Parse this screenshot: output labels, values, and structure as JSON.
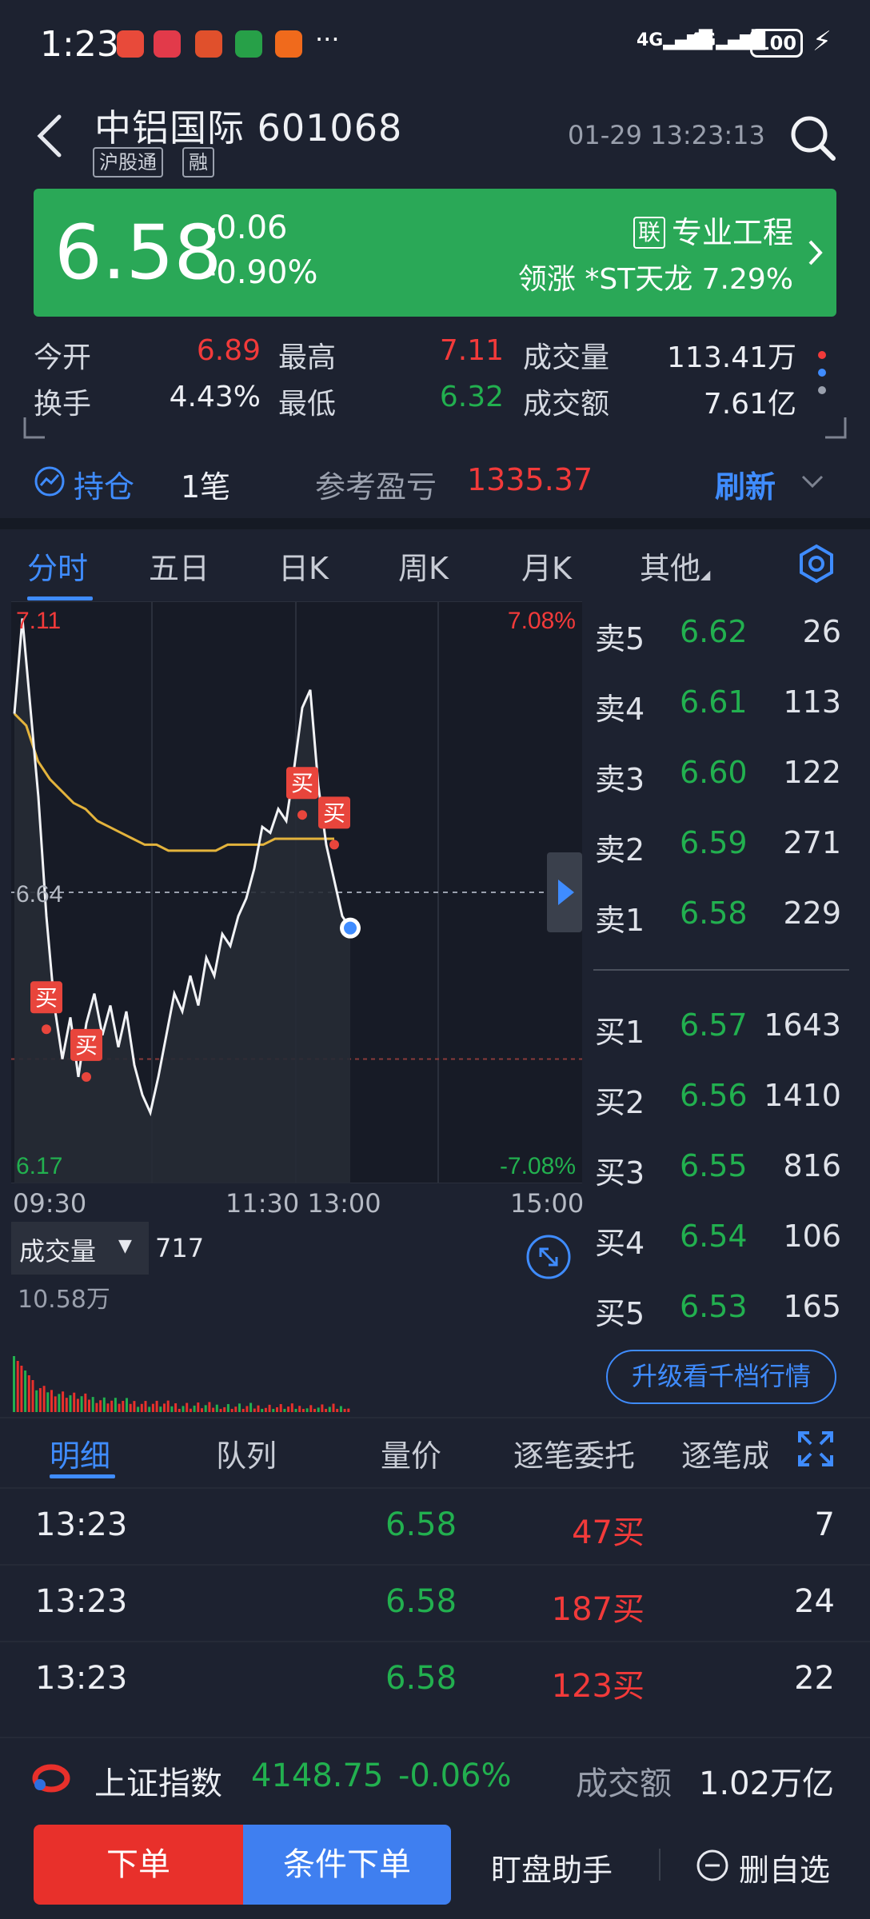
{
  "status_bar": {
    "time": "1:23",
    "more": "···",
    "net1": "4G",
    "net2": "4G",
    "battery": "100"
  },
  "header": {
    "title": "中铝国际 601068",
    "tags": [
      "沪股通",
      "融"
    ],
    "datetime": "01-29 13:23:13"
  },
  "quote": {
    "price": "6.58",
    "change": "-0.06",
    "change_pct": "-0.90%",
    "sector_tag": "联",
    "sector": "专业工程",
    "leader": "领涨 *ST天龙 7.29%"
  },
  "stats": [
    {
      "label": "今开",
      "value": "6.89",
      "color": "#f23a3a"
    },
    {
      "label": "最高",
      "value": "7.11",
      "color": "#f23a3a"
    },
    {
      "label": "成交量",
      "value": "113.41万",
      "color": "#eceef3"
    },
    {
      "label": "换手",
      "value": "4.43%",
      "color": "#eceef3"
    },
    {
      "label": "最低",
      "value": "6.32",
      "color": "#22b04f"
    },
    {
      "label": "成交额",
      "value": "7.61亿",
      "color": "#eceef3"
    }
  ],
  "position": {
    "label": "持仓",
    "count": "1笔",
    "pnl_label": "参考盈亏",
    "pnl": "1335.37",
    "refresh": "刷新"
  },
  "chart_tabs": [
    "分时",
    "五日",
    "日K",
    "周K",
    "月K",
    "其他"
  ],
  "chart": {
    "high_price": "7.11",
    "high_pct": "7.08%",
    "ref_price": "6.64",
    "low_price": "6.17",
    "low_pct": "-7.08%",
    "times": [
      "09:30",
      "11:30 13:00",
      "15:00"
    ],
    "buy_marker": "买",
    "volume_label": "成交量",
    "volume_current": "717",
    "volume_max": "10.58万"
  },
  "chart_data": {
    "type": "line",
    "ylim": [
      6.17,
      7.11
    ],
    "ref": 6.64,
    "series": [
      {
        "values": [
          6.94,
          7.1,
          6.95,
          6.8,
          6.6,
          6.45,
          6.36,
          6.43,
          6.33,
          6.42,
          6.47,
          6.4,
          6.45,
          6.38,
          6.44,
          6.35,
          6.3,
          6.27,
          6.33,
          6.4,
          6.47,
          6.44,
          6.5,
          6.45,
          6.53,
          6.5,
          6.57,
          6.55,
          6.6,
          6.63,
          6.68,
          6.75,
          6.74,
          6.78,
          6.76,
          6.85,
          6.95,
          6.98,
          6.82,
          6.72,
          6.66,
          6.6,
          6.58
        ]
      },
      {
        "values": [
          6.94,
          6.92,
          6.86,
          6.83,
          6.81,
          6.79,
          6.78,
          6.76,
          6.75,
          6.74,
          6.73,
          6.72,
          6.72,
          6.71,
          6.71,
          6.71,
          6.71,
          6.71,
          6.72,
          6.72,
          6.72,
          6.72,
          6.73,
          6.73,
          6.73,
          6.73,
          6.73,
          6.73
        ]
      }
    ]
  },
  "order_book": {
    "asks": [
      {
        "label": "卖5",
        "price": "6.62",
        "vol": "26"
      },
      {
        "label": "卖4",
        "price": "6.61",
        "vol": "113"
      },
      {
        "label": "卖3",
        "price": "6.60",
        "vol": "122"
      },
      {
        "label": "卖2",
        "price": "6.59",
        "vol": "271"
      },
      {
        "label": "卖1",
        "price": "6.58",
        "vol": "229"
      }
    ],
    "bids": [
      {
        "label": "买1",
        "price": "6.57",
        "vol": "1643"
      },
      {
        "label": "买2",
        "price": "6.56",
        "vol": "1410"
      },
      {
        "label": "买3",
        "price": "6.55",
        "vol": "816"
      },
      {
        "label": "买4",
        "price": "6.54",
        "vol": "106"
      },
      {
        "label": "买5",
        "price": "6.53",
        "vol": "165"
      }
    ],
    "upgrade": "升级看千档行情"
  },
  "detail_tabs": [
    "明细",
    "队列",
    "量价",
    "逐笔委托",
    "逐笔成交"
  ],
  "trades": [
    {
      "time": "13:23",
      "price": "6.58",
      "vol": "47买",
      "count": "7"
    },
    {
      "time": "13:23",
      "price": "6.58",
      "vol": "187买",
      "count": "24"
    },
    {
      "time": "13:23",
      "price": "6.58",
      "vol": "123买",
      "count": "22"
    }
  ],
  "index_bar": {
    "name": "上证指数",
    "value": "4148.75",
    "change": "-0.06%",
    "turnover_label": "成交额",
    "turnover": "1.02万亿"
  },
  "actions": {
    "order": "下单",
    "conditional": "条件下单",
    "assistant": "盯盘助手",
    "remove": "删自选"
  },
  "colors": {
    "up": "#f23a3a",
    "down": "#22b04f",
    "accent": "#3f8cff",
    "banner": "#2aa857"
  }
}
